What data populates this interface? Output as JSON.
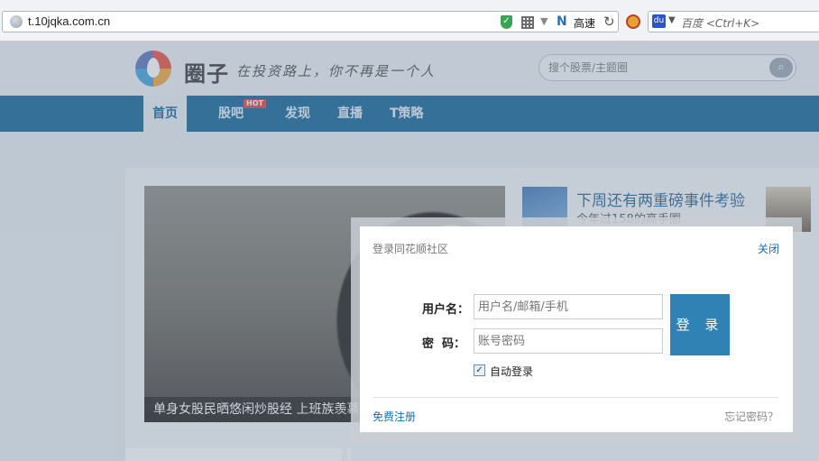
{
  "browser": {
    "url": "t.10jqka.com.cn",
    "speed_label": "高速",
    "search_placeholder": "百度 <Ctrl+K>"
  },
  "header": {
    "logo_text": "圈子",
    "slogan": "在投资路上，你不再是一个人",
    "search_placeholder": "搜个股票/主题圈"
  },
  "nav": {
    "items": [
      {
        "label": "首页",
        "active": true
      },
      {
        "label": "股吧",
        "badge": "HOT"
      },
      {
        "label": "发现"
      },
      {
        "label": "直播"
      },
      {
        "label": "T策略"
      }
    ]
  },
  "content": {
    "photo_caption": "单身女股民晒悠闲炒股经 上班族羡慕",
    "news_title": "下周还有两重磅事件考验",
    "news_sub": "今年过158的高手圈"
  },
  "login": {
    "title": "登录同花顺社区",
    "close_label": "关闭",
    "username_label": "用户名：",
    "username_placeholder": "用户名/邮箱/手机",
    "password_label": "密  码：",
    "password_placeholder": "账号密码",
    "login_button": "登 录",
    "auto_login_label": "自动登录",
    "auto_login_checked": true,
    "register_link": "免费注册",
    "forgot_link": "忘记密码？"
  },
  "colors": {
    "nav_bg": "#0a5f92",
    "login_button": "#2f82b3",
    "link": "#1d6fa8"
  }
}
